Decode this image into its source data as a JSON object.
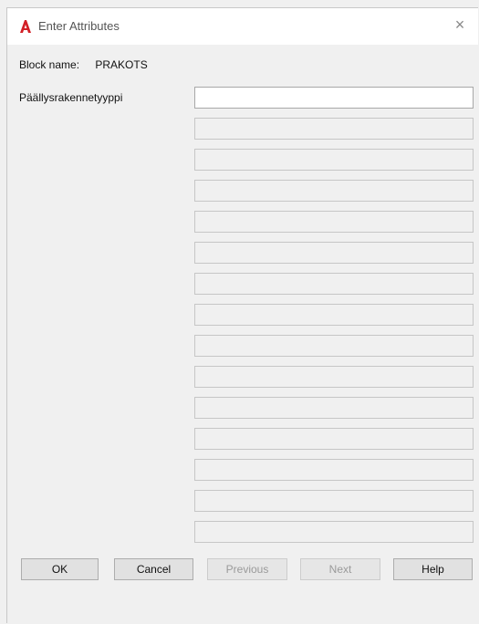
{
  "dialog": {
    "title": "Enter Attributes",
    "close_symbol": "×",
    "app_icon": "autocad-a-icon",
    "block_name_label": "Block name:",
    "block_name_value": "PRAKOTS",
    "attributes": [
      {
        "label": "Päällysrakennetyyppi",
        "value": ""
      }
    ],
    "empty_fields_count": 14,
    "buttons": {
      "ok": "OK",
      "cancel": "Cancel",
      "previous": "Previous",
      "next": "Next",
      "help": "Help"
    },
    "colors": {
      "accent_red": "#d21f26"
    }
  }
}
